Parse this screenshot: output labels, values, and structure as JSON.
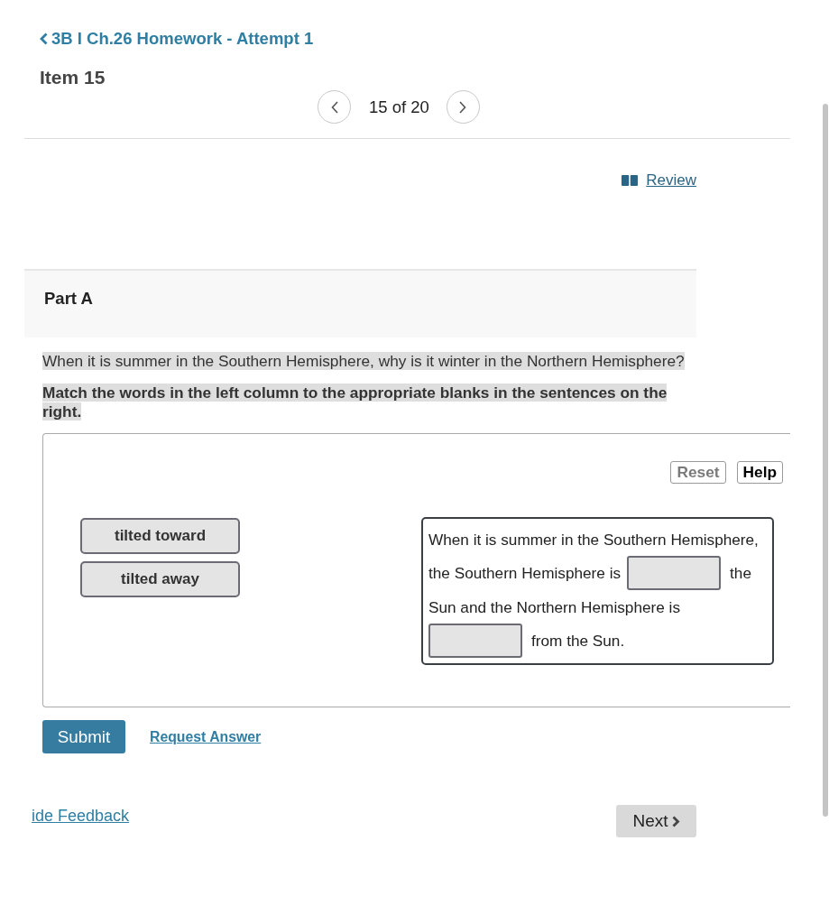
{
  "header": {
    "back_link": "3B I Ch.26 Homework - Attempt 1",
    "item_title": "Item 15",
    "page_counter": "15 of 20"
  },
  "review_link": "Review",
  "part": {
    "title": "Part A",
    "question": {
      "text": "When it is summer in the Southern Hemisphere, why is it winter in the Northern Hemisphere?",
      "highlighted": true
    },
    "instruction": {
      "text": "Match the words in the left column to the appropriate blanks in the sentences on the right.",
      "highlighted": true
    }
  },
  "activity": {
    "buttons": [
      {
        "label": "Reset",
        "disabled": true
      },
      {
        "label": "Help",
        "disabled": false
      }
    ],
    "word_tiles": [
      "tilted toward",
      "tilted away"
    ],
    "sentence_lines": [
      [
        {
          "kind": "text",
          "text": "When it is summer in the Southern Hemisphere,"
        }
      ],
      [
        {
          "kind": "text",
          "text": "the Southern Hemisphere is"
        },
        {
          "kind": "blank"
        },
        {
          "kind": "text",
          "text": "the"
        }
      ],
      [
        {
          "kind": "text",
          "text": "Sun and the Northern Hemisphere is"
        }
      ],
      [
        {
          "kind": "blank"
        },
        {
          "kind": "text",
          "text": "from the Sun."
        }
      ]
    ]
  },
  "actions": {
    "submit": "Submit",
    "request_answer": "Request Answer"
  },
  "footer": {
    "feedback_link": "ide Feedback",
    "next": "Next"
  }
}
